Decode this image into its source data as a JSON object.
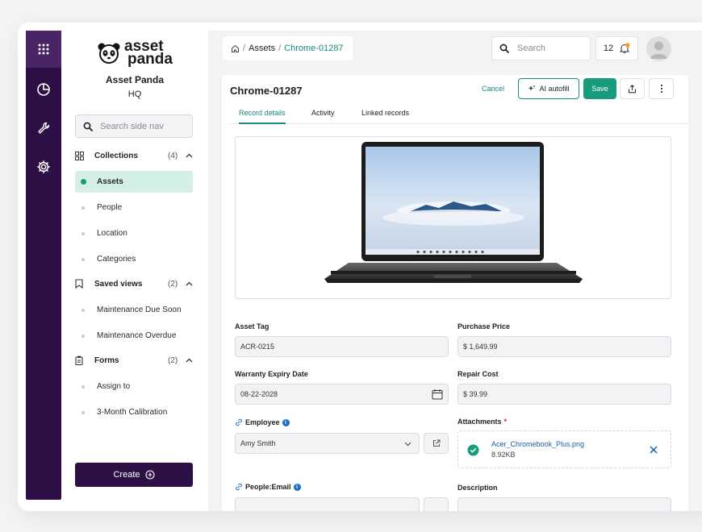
{
  "brand": {
    "logo_line1": "asset",
    "logo_line2": "panda",
    "name": "Asset Panda",
    "subtitle": "HQ"
  },
  "rail": {
    "icons": [
      "grid-icon",
      "pie-chart-icon",
      "wrench-icon",
      "gear-icon"
    ]
  },
  "sidenav": {
    "search_placeholder": "Search side nav",
    "groups": [
      {
        "label": "Collections",
        "count": "(4)",
        "items": [
          "Assets",
          "People",
          "Location",
          "Categories"
        ]
      },
      {
        "label": "Saved views",
        "count": "(2)",
        "items": [
          "Maintenance Due Soon",
          "Maintenance Overdue"
        ]
      },
      {
        "label": "Forms",
        "count": "(2)",
        "items": [
          "Assign to",
          "3-Month Calibration"
        ]
      }
    ],
    "active_item": "Assets",
    "create_label": "Create"
  },
  "header": {
    "breadcrumb": {
      "sep1": "/",
      "section": "Assets",
      "sep2": "/",
      "current": "Chrome-01287"
    },
    "search_placeholder": "Search",
    "notification_count": "12"
  },
  "record": {
    "title": "Chrome-01287",
    "actions": {
      "cancel": "Cancel",
      "ai_autofill": "AI autofill",
      "save": "Save"
    },
    "tabs": [
      "Record details",
      "Activity",
      "Linked records"
    ],
    "active_tab": "Record details",
    "fields": {
      "asset_tag": {
        "label": "Asset Tag",
        "value": "ACR-0215"
      },
      "purchase_price": {
        "label": "Purchase Price",
        "value": "$ 1,649.99"
      },
      "warranty_expiry": {
        "label": "Warranty Expiry Date",
        "value": "08-22-2028"
      },
      "repair_cost": {
        "label": "Repair Cost",
        "value": "$ 39.99"
      },
      "employee": {
        "label": "Employee",
        "value": "Amy Smith"
      },
      "attachments": {
        "label": "Attachments",
        "required_mark": "*",
        "file_name": "Acer_Chromebook_Plus.png",
        "file_size": "8.92KB"
      },
      "people_email": {
        "label": "People:Email"
      },
      "description": {
        "label": "Description"
      }
    }
  },
  "colors": {
    "primary": "#2c0f44",
    "accent": "#178b7d",
    "active_bg": "#d4efe5",
    "info": "#1a6fc4",
    "notif_dot": "#f0a020"
  }
}
